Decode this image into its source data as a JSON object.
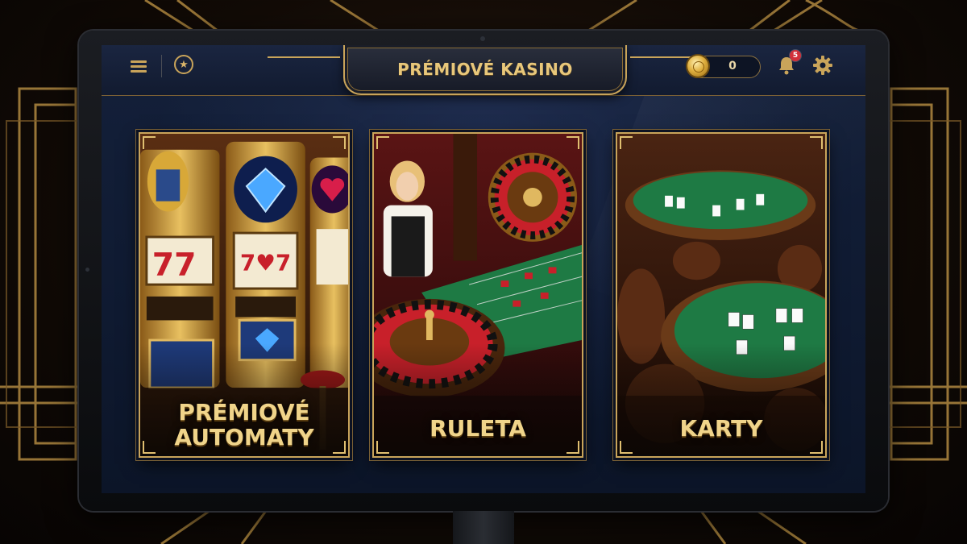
{
  "app": {
    "title": "PRÉMIOVÉ KASINO"
  },
  "header": {
    "menu_icon": "hamburger-menu-icon",
    "favorites_icon": "star-icon",
    "balance": "0",
    "coin_icon": "gold-coin-icon",
    "notifications_icon": "bell-icon",
    "notifications_count": "5",
    "settings_icon": "gear-icon"
  },
  "games": [
    {
      "id": "slots",
      "label_line1": "PRÉMIOVÉ",
      "label_line2": "AUTOMATY",
      "art": "slot-machines"
    },
    {
      "id": "roulette",
      "label_line1": "RULETA",
      "art": "roulette-table-with-dealer"
    },
    {
      "id": "cards",
      "label_line1": "KARTY",
      "art": "poker-tables"
    }
  ],
  "colors": {
    "gold": "#c9a45a",
    "gold_text": "#f0d48a",
    "screen_bg": "#0f1a31",
    "badge_red": "#d2303a"
  }
}
